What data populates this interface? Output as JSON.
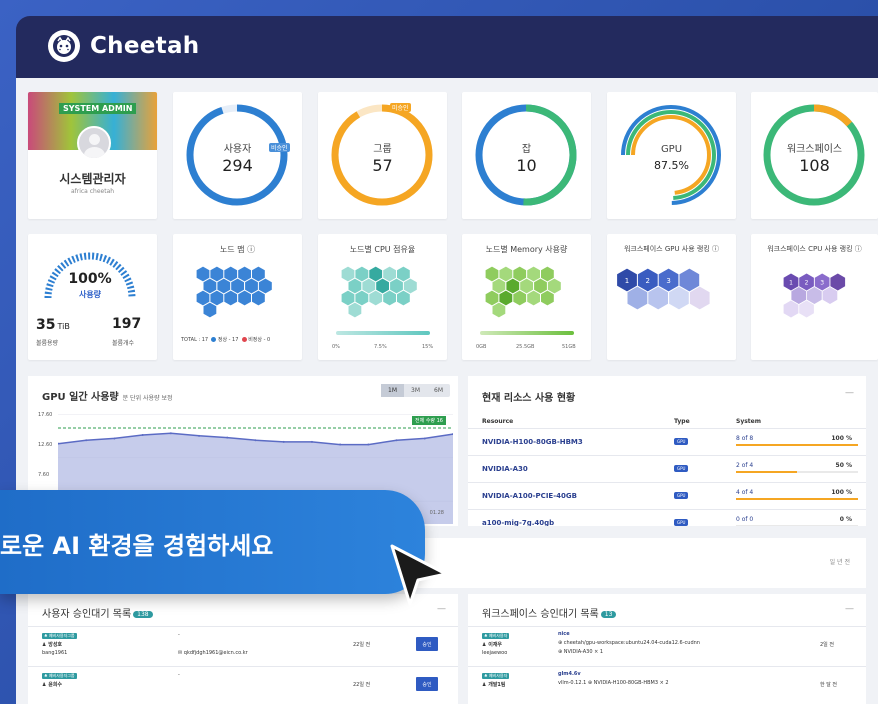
{
  "app": {
    "name": "Cheetah"
  },
  "admin": {
    "badge": "SYSTEM ADMIN",
    "name": "시스템관리자",
    "sub": "africa cheetah"
  },
  "stats": [
    {
      "label": "사용자",
      "value": "294",
      "tag": "비승인"
    },
    {
      "label": "그룹",
      "value": "57",
      "tag": "미승인"
    },
    {
      "label": "잡",
      "value": "10"
    },
    {
      "label": "GPU",
      "value": "87.5%"
    },
    {
      "label": "워크스페이스",
      "value": "108"
    }
  ],
  "storage": {
    "percent": "100%",
    "usage_label": "사용량",
    "capacity": "35",
    "capacity_unit": "TiB",
    "capacity_label": "볼륨용량",
    "count": "197",
    "count_label": "볼륨개수"
  },
  "node_map": {
    "title": "노드 맵 ⓘ",
    "legend_total": "TOTAL : 17",
    "legend_ok": "정상 - 17",
    "legend_bad": "비정상 - 0"
  },
  "node_cpu": {
    "title": "노드별 CPU 점유율",
    "ticks": [
      "0%",
      "7.5%",
      "15%"
    ],
    "fill": 1.0
  },
  "node_mem": {
    "title": "노드별 Memory 사용량",
    "ticks": [
      "0GB",
      "25.5GB",
      "51GB"
    ],
    "fill": 0.92
  },
  "ws_gpu_rank": {
    "title": "워크스페이스 GPU 사용 랭킹 ⓘ",
    "ranks": [
      "1",
      "2",
      "3"
    ]
  },
  "ws_cpu_rank": {
    "title": "워크스페이스 CPU 사용 랭킹 ⓘ",
    "ranks": [
      "1",
      "2",
      "3"
    ]
  },
  "gpu_daily": {
    "title": "GPU 일간 사용량",
    "subtitle": "분 단위 사용량 보정",
    "tabs": [
      "1M",
      "3M",
      "6M"
    ],
    "y_ticks": [
      "17.60",
      "12.60",
      "7.60"
    ],
    "total_tag": "전체 수량 16",
    "x_tail": "01.28"
  },
  "chart_data": {
    "type": "area",
    "title": "GPU 일간 사용량",
    "y_ticks": [
      17.6,
      12.6,
      7.6
    ],
    "ylim": [
      5,
      17.6
    ],
    "series": [
      {
        "name": "",
        "values": [
          14.2,
          14.6,
          14.8,
          15.2,
          15.4,
          15.1,
          14.9,
          14.6,
          14.4,
          14.4,
          14.1,
          14.1,
          14.6,
          14.8,
          15.3
        ]
      }
    ]
  },
  "resources": {
    "title": "현재 리소스 사용 현황",
    "headers": {
      "resource": "Resource",
      "type": "Type",
      "system": "System"
    },
    "rows": [
      {
        "name": "NVIDIA-H100-80GB-HBM3",
        "type": "GPU",
        "system": "8 of 8",
        "pct": "100 %",
        "fill": 1.0
      },
      {
        "name": "NVIDIA-A30",
        "type": "GPU",
        "system": "2 of 4",
        "pct": "50 %",
        "fill": 0.5
      },
      {
        "name": "NVIDIA-A100-PCIE-40GB",
        "type": "GPU",
        "system": "4 of 4",
        "pct": "100 %",
        "fill": 1.0
      },
      {
        "name": "a100-mig-7g.40gb",
        "type": "GPU",
        "system": "0 of 0",
        "pct": "0 %",
        "fill": 0.0
      }
    ],
    "dash": "—"
  },
  "mid_strip": {
    "right_text": "일 년 전"
  },
  "user_approvals": {
    "title": "사용자 승인대기 목록",
    "count": "138",
    "dash": "—",
    "rows": [
      {
        "tag": "♣ 예비사용자그룹",
        "name": "♟ 방성호",
        "id": "bang1961",
        "dash": "-",
        "email": "✉ qkdfjdgh1961@eicn.co.kr",
        "time": "22일 전",
        "btn": "승인"
      },
      {
        "tag": "♣ 예비사용자그룹",
        "name": "♟ 윤희수",
        "id": "",
        "dash": "-",
        "email": "",
        "time": "22일 전",
        "btn": "승인"
      }
    ]
  },
  "ws_approvals": {
    "title": "워크스페이스 승인대기 목록",
    "count": "13",
    "dash": "—",
    "rows": [
      {
        "tag": "♣ 예비사용자",
        "name": "♟ 이재우",
        "id": "leejaewoo",
        "ws": "nice",
        "image": "⊕ cheetah/gpu-workspace:ubuntu24.04-cuda12.6-cudnn",
        "gpu": "⊕ NVIDIA-A30 × 1",
        "time": "2일 전"
      },
      {
        "tag": "♣ 예비사용자",
        "name": "♟ 개발1팀",
        "id": "",
        "ws": "glm4.6v",
        "image": "vllm-0.12.1 ⊕ NVIDIA-H100-80GB-HBM3 × 2",
        "gpu": "",
        "time": "한 달 전"
      }
    ]
  },
  "banner": {
    "text": "로운 AI 환경을 경험하세요"
  },
  "colors": {
    "header": "#232a5e",
    "accent_blue": "#2f5bc2",
    "accent_orange": "#f5a623",
    "accent_green": "#3cb878",
    "teal": "#2e9aa0"
  }
}
